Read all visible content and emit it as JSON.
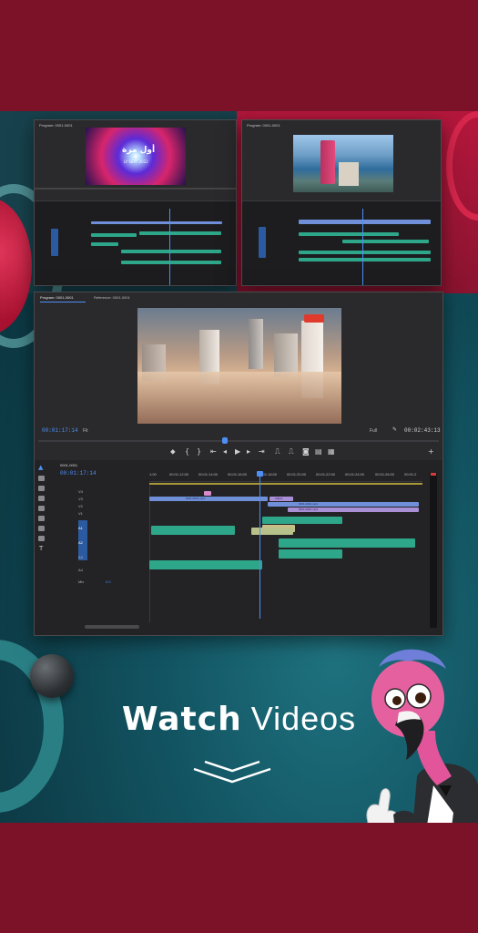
{
  "hero": {
    "title_bold": "Watch",
    "title_light": "Videos"
  },
  "preview_left": {
    "tab": "Program: 0001-0001",
    "overlay_text_1": "أول مرة",
    "overlay_text_2": "LY SEPT 2022"
  },
  "preview_right": {
    "tab": "Program: 0001-0001"
  },
  "main_editor": {
    "program_tab": "Program: 0001-0001",
    "reference_tab": "Reference: 0001-0001",
    "current_timecode": "00:01:17:14",
    "fit_label": "Fit",
    "full_label": "Full",
    "duration_timecode": "00:02:43:13",
    "sequence_tab": "0001-0001",
    "timeline_timecode": "00:01:17:14",
    "ruler_labels": [
      "1:00",
      "00:01:12:00",
      "00:01:14:00",
      "00:01:16:00",
      "00:01:18:00",
      "00:01:20:00",
      "00:01:22:00",
      "00:01:24:00",
      "00:01:26:00",
      "00:01:2"
    ],
    "video_tracks": [
      "V4",
      "V3",
      "V2",
      "V1"
    ],
    "audio_tracks": [
      "A1",
      "A2",
      "A3",
      "A4"
    ],
    "master_label": "Mix",
    "master_value": "0.0",
    "clip_labels": [
      "0001-0001.mp4",
      "0001-0001.mp4",
      "Adjust",
      "0001-0001.mp4"
    ],
    "colors": {
      "accent": "#4e8ff7",
      "audio_clip": "#2ea68a",
      "video_clip": "#6f8fd8",
      "adjust_clip": "#a98fd6"
    }
  },
  "icons": [
    "selection-tool-icon",
    "track-select-icon",
    "ripple-edit-icon",
    "razor-icon",
    "slip-icon",
    "pen-icon",
    "rectangle-icon",
    "hand-icon",
    "type-icon",
    "play-icon",
    "step-back-icon",
    "step-forward-icon",
    "mark-in-icon",
    "mark-out-icon",
    "export-frame-icon",
    "plus-icon",
    "wrench-icon"
  ]
}
